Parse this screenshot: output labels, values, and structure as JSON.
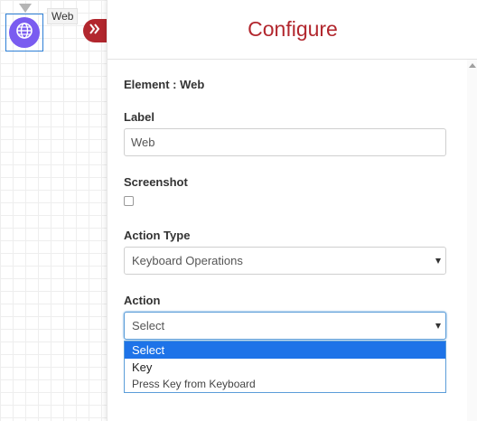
{
  "canvas": {
    "node": {
      "label": "Web",
      "icon": "globe-icon"
    },
    "collapse_icon": "double-chevron-right-icon"
  },
  "panel": {
    "title": "Configure",
    "element_line": "Element : Web",
    "label": {
      "title": "Label",
      "value": "Web"
    },
    "screenshot": {
      "title": "Screenshot",
      "checked": false
    },
    "action_type": {
      "title": "Action Type",
      "value": "Keyboard Operations"
    },
    "action": {
      "title": "Action",
      "value": "Select",
      "options": {
        "selected": "Select",
        "group": "Key",
        "item": "Press Key from Keyboard"
      }
    }
  },
  "colors": {
    "accent": "#b2272e",
    "node": "#7a5cf0",
    "highlight": "#1e73e8"
  }
}
